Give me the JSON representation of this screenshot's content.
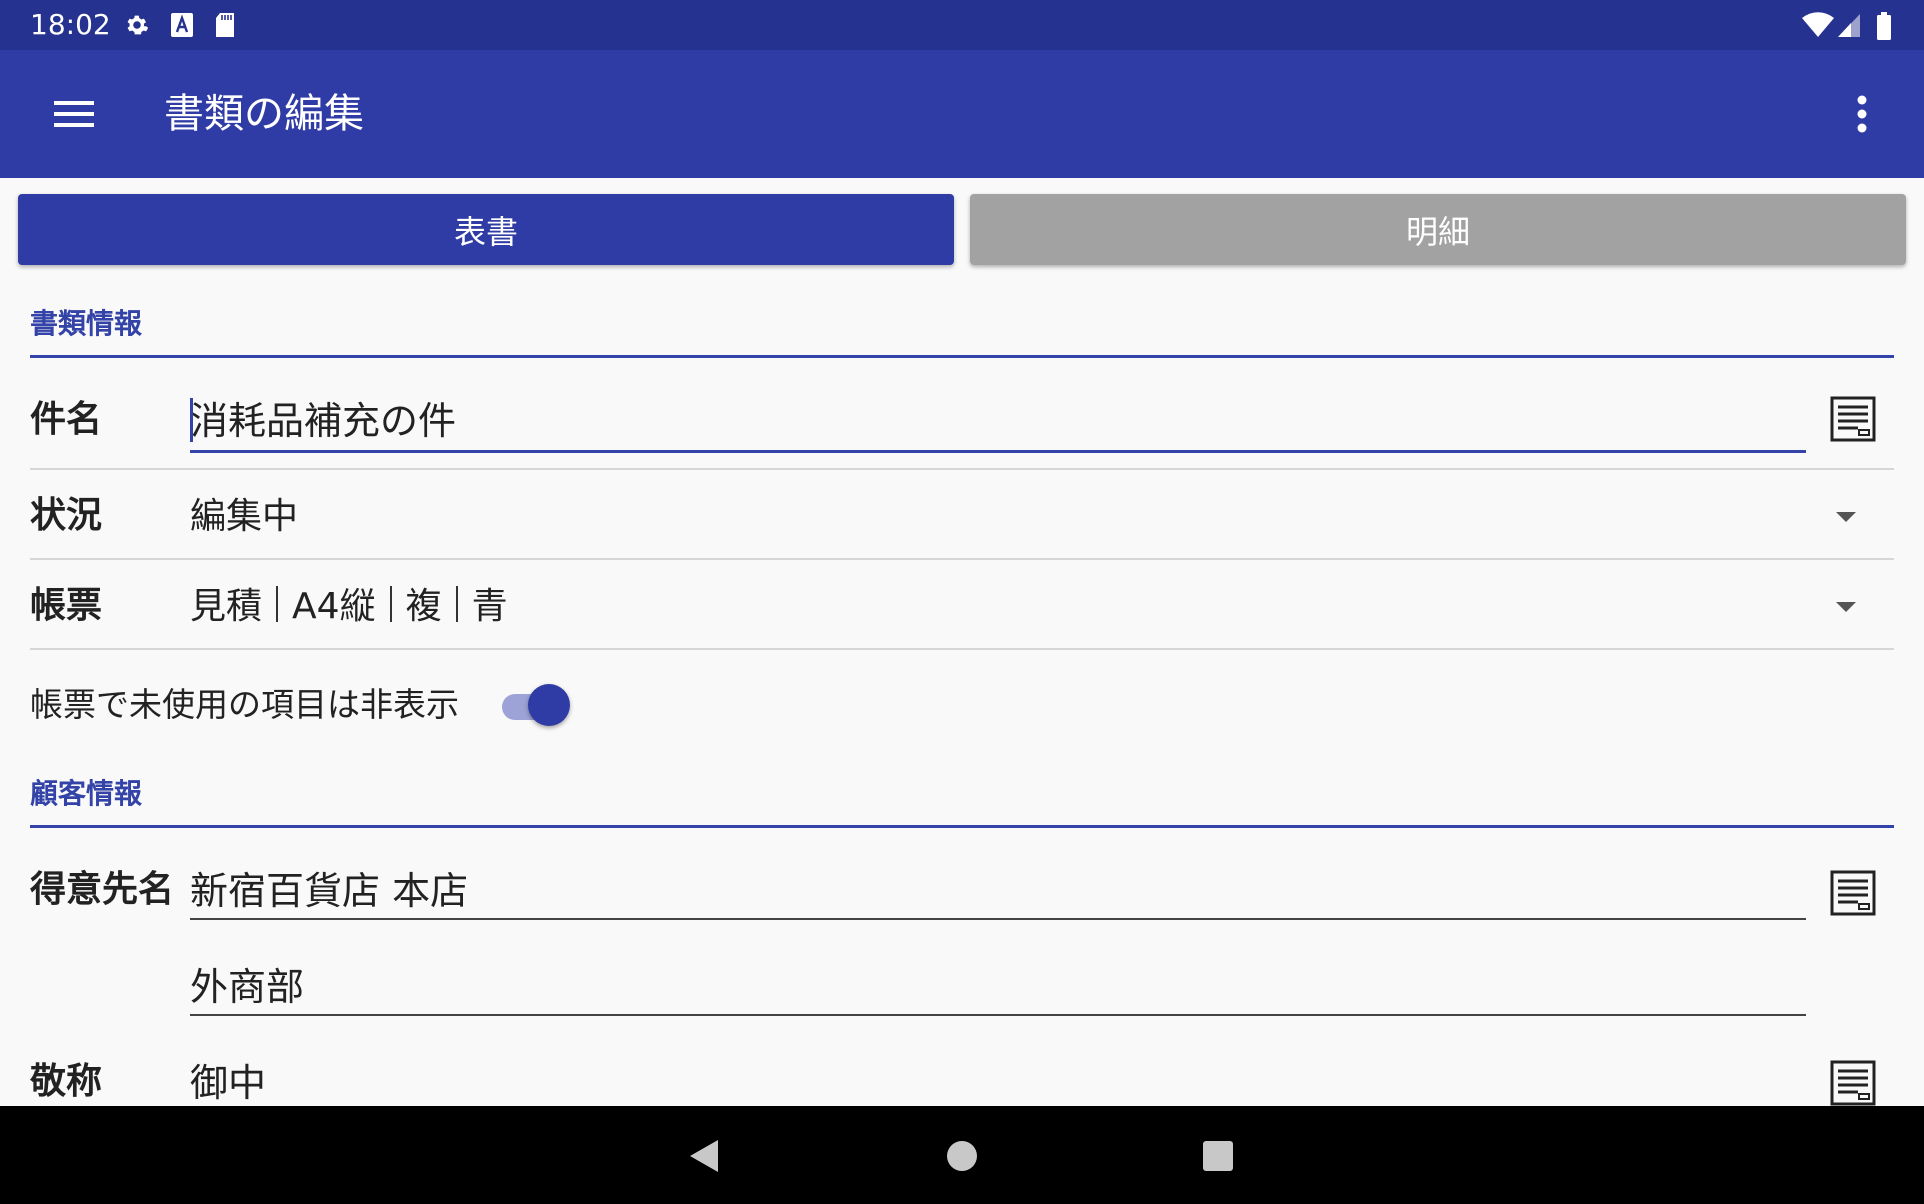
{
  "status_bar": {
    "time": "18:02",
    "left_icons": [
      "gear-icon",
      "keyboard-a-icon",
      "sd-card-icon"
    ],
    "right_icons": [
      "wifi-icon",
      "signal-icon",
      "battery-icon"
    ]
  },
  "app_bar": {
    "title": "書類の編集",
    "menu_icon": "hamburger-menu-icon",
    "more_icon": "more-vert-icon"
  },
  "tabs": [
    {
      "label": "表書",
      "active": true
    },
    {
      "label": "明細",
      "active": false
    }
  ],
  "document_info": {
    "section_title": "書類情報",
    "subject": {
      "label": "件名",
      "value": "消耗品補充の件"
    },
    "status": {
      "label": "状況",
      "value": "編集中"
    },
    "form": {
      "label": "帳票",
      "parts": [
        "見積",
        "A4縦",
        "複",
        "青"
      ]
    },
    "hide_unused": {
      "label": "帳票で未使用の項目は非表示",
      "checked": true
    }
  },
  "customer_info": {
    "section_title": "顧客情報",
    "customer_name": {
      "label": "得意先名",
      "line1": "新宿百貨店 本店",
      "line2": "外商部"
    },
    "honorific": {
      "label": "敬称",
      "value": "御中"
    }
  },
  "nav_bar": {
    "icons": [
      "back-icon",
      "home-icon",
      "recents-icon"
    ]
  },
  "colors": {
    "status_bar": "#25328f",
    "app_bar": "#303ca6",
    "accent": "#3443a8",
    "tab_inactive": "#a2a2a2",
    "background": "#f9f9f9"
  }
}
